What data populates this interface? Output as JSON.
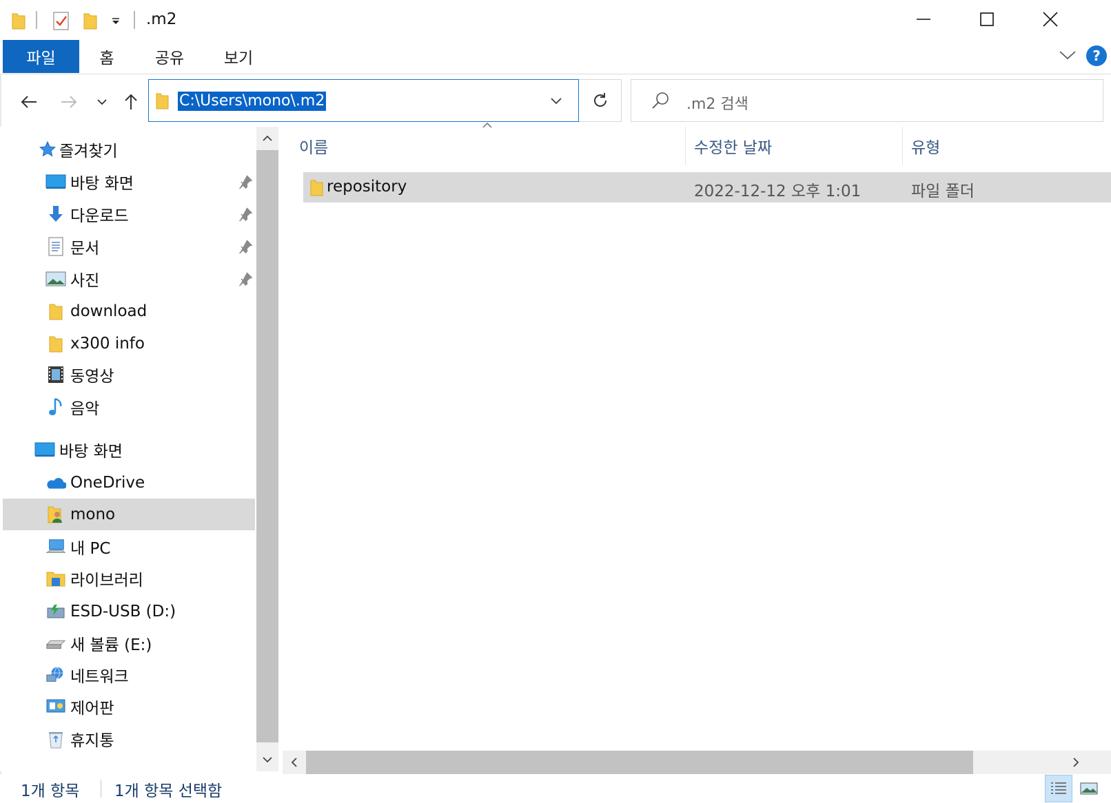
{
  "window": {
    "title": ".m2"
  },
  "ribbon": {
    "tabs": [
      "파일",
      "홈",
      "공유",
      "보기"
    ],
    "help_label": "?"
  },
  "navbar": {
    "address_path": "C:\\Users\\mono\\.m2",
    "search_placeholder": ".m2 검색"
  },
  "sidebar": {
    "quick_access": "즐겨찾기",
    "pinned": [
      "바탕 화면",
      "다운로드",
      "문서",
      "사진"
    ],
    "folders": [
      "download",
      "x300 info",
      "동영상",
      "음악"
    ],
    "desktop": "바탕 화면",
    "onedrive": "OneDrive",
    "user": "mono",
    "this_pc": "내 PC",
    "libraries": "라이브러리",
    "esd_usb": "ESD-USB (D:)",
    "new_volume": "새 볼륨 (E:)",
    "network": "네트워크",
    "control_panel": "제어판",
    "recycle_bin": "휴지통"
  },
  "content": {
    "columns": {
      "name": "이름",
      "modified": "수정한 날짜",
      "type": "유형"
    },
    "rows": [
      {
        "name": "repository",
        "modified": "2022-12-12 오후 1:01",
        "type": "파일 폴더"
      }
    ]
  },
  "status": {
    "item_count": "1개 항목",
    "selected": "1개 항목 선택함"
  },
  "colors": {
    "accent": "#0f67c0",
    "selection": "#d9d9d9",
    "folder": "#f5c94a"
  },
  "icons": [
    "folder-icon",
    "checklist-icon",
    "back-icon",
    "forward-icon",
    "up-icon",
    "refresh-icon",
    "search-icon",
    "star-icon",
    "pin-icon",
    "desktop-icon",
    "download-icon",
    "document-icon",
    "pictures-icon",
    "video-icon",
    "music-icon",
    "onedrive-icon",
    "user-folder-icon",
    "pc-icon",
    "library-icon",
    "usb-drive-icon",
    "drive-icon",
    "network-icon",
    "control-panel-icon",
    "recycle-bin-icon",
    "details-view-icon",
    "large-icons-view-icon"
  ]
}
